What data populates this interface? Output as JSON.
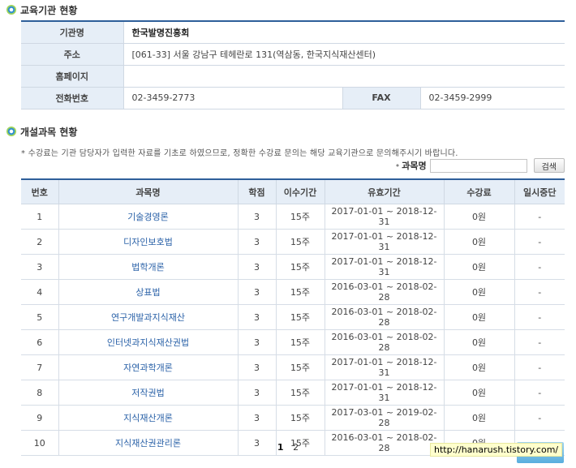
{
  "institution": {
    "section_title": "교육기관 현황",
    "name_label": "기관명",
    "name": "한국발명진흥회",
    "address_label": "주소",
    "address": "[061-33] 서울 강남구 테헤란로 131(역삼동, 한국지식재산센터)",
    "homepage_label": "홈페이지",
    "homepage": "",
    "phone_label": "전화번호",
    "phone": "02-3459-2773",
    "fax_label": "FAX",
    "fax": "02-3459-2999"
  },
  "courses": {
    "section_title": "개설과목 현황",
    "notice": "* 수강료는 기관 담당자가 입력한 자료를 기초로 하였으므로, 정확한 수강료 문의는 해당 교육기관으로 문의해주시기 바랍니다.",
    "search": {
      "bullet": "•",
      "label": "과목명",
      "value": "",
      "placeholder": "",
      "button": "검색"
    },
    "columns": {
      "no": "번호",
      "name": "과목명",
      "credit": "학점",
      "period": "이수기간",
      "validity": "유효기간",
      "fee": "수강료",
      "suspend": "일시중단"
    },
    "rows": [
      {
        "no": "1",
        "name": "기술경영론",
        "credit": "3",
        "period": "15주",
        "validity": "2017-01-01 ~ 2018-12-31",
        "fee": "0원",
        "suspend": "-"
      },
      {
        "no": "2",
        "name": "디자인보호법",
        "credit": "3",
        "period": "15주",
        "validity": "2017-01-01 ~ 2018-12-31",
        "fee": "0원",
        "suspend": "-"
      },
      {
        "no": "3",
        "name": "법학개론",
        "credit": "3",
        "period": "15주",
        "validity": "2017-01-01 ~ 2018-12-31",
        "fee": "0원",
        "suspend": "-"
      },
      {
        "no": "4",
        "name": "상표법",
        "credit": "3",
        "period": "15주",
        "validity": "2016-03-01 ~ 2018-02-28",
        "fee": "0원",
        "suspend": "-"
      },
      {
        "no": "5",
        "name": "연구개발과지식재산",
        "credit": "3",
        "period": "15주",
        "validity": "2016-03-01 ~ 2018-02-28",
        "fee": "0원",
        "suspend": "-"
      },
      {
        "no": "6",
        "name": "인터넷과지식재산권법",
        "credit": "3",
        "period": "15주",
        "validity": "2016-03-01 ~ 2018-02-28",
        "fee": "0원",
        "suspend": "-"
      },
      {
        "no": "7",
        "name": "자연과학개론",
        "credit": "3",
        "period": "15주",
        "validity": "2017-01-01 ~ 2018-12-31",
        "fee": "0원",
        "suspend": "-"
      },
      {
        "no": "8",
        "name": "저작권법",
        "credit": "3",
        "period": "15주",
        "validity": "2017-01-01 ~ 2018-12-31",
        "fee": "0원",
        "suspend": "-"
      },
      {
        "no": "9",
        "name": "지식재산개론",
        "credit": "3",
        "period": "15주",
        "validity": "2017-03-01 ~ 2019-02-28",
        "fee": "0원",
        "suspend": "-"
      },
      {
        "no": "10",
        "name": "지식재산권관리론",
        "credit": "3",
        "period": "15주",
        "validity": "2016-03-01 ~ 2018-02-28",
        "fee": "0원",
        "suspend": "-"
      }
    ]
  },
  "pagination": {
    "pages": [
      "1",
      "2"
    ],
    "current": "1"
  },
  "watermark": "http://hanarush.tistory.com/",
  "colors": {
    "accent": "#2e5f9a",
    "header_bg": "#e6eef7",
    "link": "#2b62a8"
  }
}
